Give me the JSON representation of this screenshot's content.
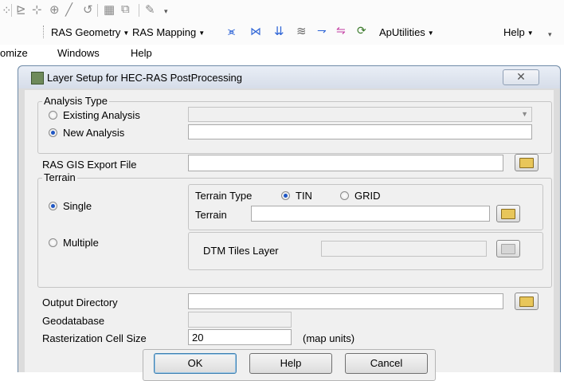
{
  "toolbar_top": {
    "icons": [
      "node-icon",
      "vertex-icon",
      "add-point-icon",
      "line-icon",
      "undo-icon",
      "grid-icon",
      "image-icon",
      "edit-icon",
      "overflow-icon"
    ]
  },
  "toolbar_menu": {
    "ras_geometry": "RAS Geometry",
    "ras_mapping": "RAS Mapping",
    "aputilities": "ApUtilities",
    "help": "Help"
  },
  "menubar": {
    "customize_partial": "omize",
    "windows": "Windows",
    "help": "Help"
  },
  "dialog": {
    "title": "Layer Setup for HEC-RAS PostProcessing",
    "close_glyph": "✕",
    "analysis_type": {
      "legend": "Analysis Type",
      "existing_label": "Existing Analysis",
      "new_label": "New Analysis",
      "selected": "New Analysis",
      "existing_value": "",
      "new_value": ""
    },
    "export_file": {
      "label": "RAS GIS Export File",
      "value": ""
    },
    "terrain": {
      "legend": "Terrain",
      "single_label": "Single",
      "multiple_label": "Multiple",
      "selected": "Single",
      "type_label": "Terrain Type",
      "tin_label": "TIN",
      "grid_label": "GRID",
      "type_selected": "TIN",
      "terrain_label": "Terrain",
      "terrain_value": "",
      "dtm_label": "DTM Tiles Layer",
      "dtm_value": ""
    },
    "output_directory": {
      "label": "Output Directory",
      "value": ""
    },
    "geodatabase": {
      "label": "Geodatabase",
      "value": ""
    },
    "cell_size": {
      "label": "Rasterization Cell Size",
      "value": "20",
      "units": "(map units)"
    },
    "buttons": {
      "ok": "OK",
      "help": "Help",
      "cancel": "Cancel"
    }
  },
  "colors": {
    "radio_selected": "#1e56c4",
    "window_border": "#6f8aa8"
  }
}
